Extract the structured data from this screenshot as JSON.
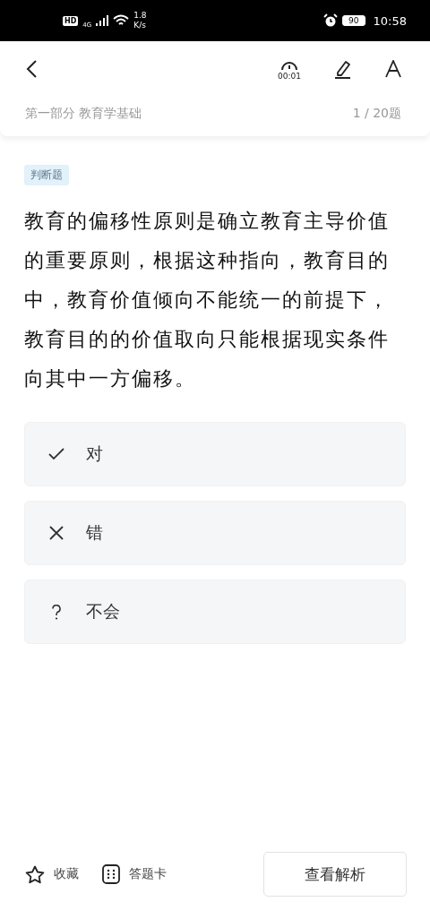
{
  "status_bar": {
    "hd": "HD",
    "network": "4G",
    "speed_value": "1.8",
    "speed_unit": "K/s",
    "battery": "90",
    "time": "10:58"
  },
  "toolbar": {
    "timer": "00:01"
  },
  "header": {
    "section": "第一部分  教育学基础",
    "progress": "1 / 20题"
  },
  "question": {
    "type_tag": "判断题",
    "text": "教育的偏移性原则是确立教育主导价值的重要原则，根据这种指向，教育目的中，教育价值倾向不能统一的前提下，教育目的的价值取向只能根据现实条件向其中一方偏移。"
  },
  "options": [
    {
      "kind": "check",
      "label": "对",
      "selected": false
    },
    {
      "kind": "cross",
      "label": "错",
      "selected": false
    },
    {
      "kind": "question",
      "label": "不会",
      "selected": false
    }
  ],
  "bottom_bar": {
    "favorite": "收藏",
    "answer_card": "答题卡",
    "analysis_button": "查看解析"
  }
}
